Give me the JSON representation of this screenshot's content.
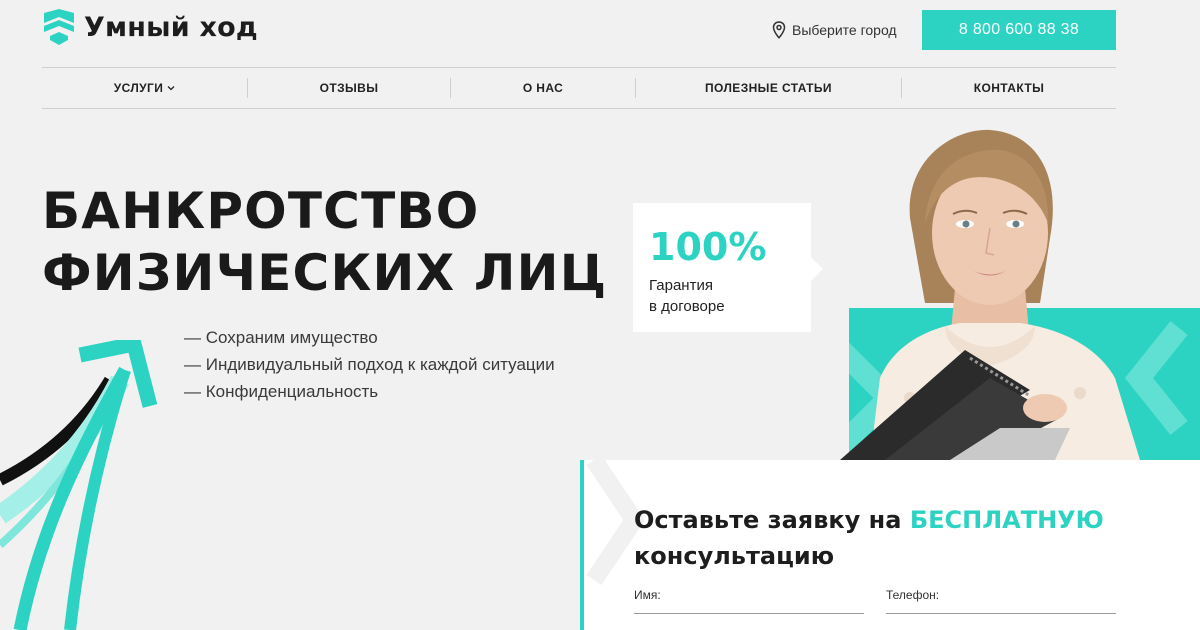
{
  "brand": {
    "name": "Умный ход",
    "accent_color": "#2dd3c2"
  },
  "header": {
    "city_label": "Выберите город",
    "city_icon": "location-pin-icon",
    "phone": "8 800 600 88 38"
  },
  "nav": {
    "items": [
      {
        "label": "УСЛУГИ",
        "has_dropdown": true
      },
      {
        "label": "ОТЗЫВЫ"
      },
      {
        "label": "О НАС"
      },
      {
        "label": "ПОЛЕЗНЫЕ СТАТЬИ"
      },
      {
        "label": "КОНТАКТЫ"
      }
    ]
  },
  "hero": {
    "title_line1": "БАНКРОТСТВО",
    "title_line2": "ФИЗИЧЕСКИХ ЛИЦ",
    "benefits": [
      "— Сохраним имущество",
      "— Индивидуальный подход к каждой ситуации",
      "— Конфиденциальность"
    ]
  },
  "badge": {
    "value": "100%",
    "text_line1": "Гарантия",
    "text_line2": "в договоре"
  },
  "form": {
    "title_part1": "Оставьте заявку на ",
    "title_accent": "БЕСПЛАТНУЮ",
    "title_part2": "консультацию",
    "name_label": "Имя:",
    "phone_label": "Телефон:"
  }
}
